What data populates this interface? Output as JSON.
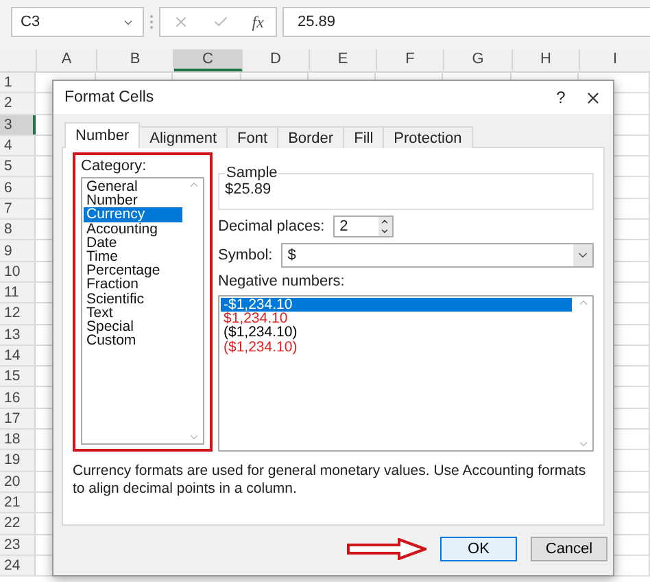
{
  "formula_bar": {
    "name_box": "C3",
    "function_label": "fx",
    "formula": "25.89"
  },
  "grid": {
    "columns": [
      {
        "label": "A",
        "selected": false
      },
      {
        "label": "B",
        "selected": false
      },
      {
        "label": "C",
        "selected": true
      },
      {
        "label": "D",
        "selected": false
      },
      {
        "label": "E",
        "selected": false
      },
      {
        "label": "F",
        "selected": false
      },
      {
        "label": "G",
        "selected": false
      },
      {
        "label": "H",
        "selected": false
      },
      {
        "label": "I",
        "selected": false
      }
    ],
    "rows": [
      {
        "label": "1",
        "selected": false
      },
      {
        "label": "2",
        "selected": false
      },
      {
        "label": "3",
        "selected": true
      },
      {
        "label": "4",
        "selected": false
      },
      {
        "label": "5",
        "selected": false
      },
      {
        "label": "6",
        "selected": false
      },
      {
        "label": "7",
        "selected": false
      },
      {
        "label": "8",
        "selected": false
      },
      {
        "label": "9",
        "selected": false
      },
      {
        "label": "10",
        "selected": false
      },
      {
        "label": "11",
        "selected": false
      },
      {
        "label": "12",
        "selected": false
      },
      {
        "label": "13",
        "selected": false
      },
      {
        "label": "14",
        "selected": false
      },
      {
        "label": "15",
        "selected": false
      },
      {
        "label": "16",
        "selected": false
      },
      {
        "label": "17",
        "selected": false
      },
      {
        "label": "18",
        "selected": false
      },
      {
        "label": "19",
        "selected": false
      },
      {
        "label": "20",
        "selected": false
      },
      {
        "label": "21",
        "selected": false
      },
      {
        "label": "22",
        "selected": false
      },
      {
        "label": "23",
        "selected": false
      },
      {
        "label": "24",
        "selected": false
      }
    ]
  },
  "dialog": {
    "title": "Format Cells",
    "help": "?",
    "tabs": [
      {
        "label": "Number",
        "selected": true
      },
      {
        "label": "Alignment",
        "selected": false
      },
      {
        "label": "Font",
        "selected": false
      },
      {
        "label": "Border",
        "selected": false
      },
      {
        "label": "Fill",
        "selected": false
      },
      {
        "label": "Protection",
        "selected": false
      }
    ],
    "category_label": "Category:",
    "categories": [
      {
        "label": "General",
        "selected": false
      },
      {
        "label": "Number",
        "selected": false
      },
      {
        "label": "Currency",
        "selected": true
      },
      {
        "label": "Accounting",
        "selected": false
      },
      {
        "label": "Date",
        "selected": false
      },
      {
        "label": "Time",
        "selected": false
      },
      {
        "label": "Percentage",
        "selected": false
      },
      {
        "label": "Fraction",
        "selected": false
      },
      {
        "label": "Scientific",
        "selected": false
      },
      {
        "label": "Text",
        "selected": false
      },
      {
        "label": "Special",
        "selected": false
      },
      {
        "label": "Custom",
        "selected": false
      }
    ],
    "sample": {
      "label": "Sample",
      "value": "$25.89"
    },
    "decimal_places": {
      "label": "Decimal places:",
      "value": "2"
    },
    "symbol": {
      "label": "Symbol:",
      "value": "$"
    },
    "negative_numbers_label": "Negative numbers:",
    "negative_numbers": [
      {
        "label": "-$1,234.10",
        "selected": true,
        "color": "#ffffff"
      },
      {
        "label": "$1,234.10",
        "selected": false,
        "color": "#e02020"
      },
      {
        "label": "($1,234.10)",
        "selected": false,
        "color": "#000000"
      },
      {
        "label": "($1,234.10)",
        "selected": false,
        "color": "#e02020"
      }
    ],
    "description": "Currency formats are used for general monetary values.  Use Accounting formats to align decimal points in a column.",
    "buttons": [
      {
        "label": "OK",
        "default": true
      },
      {
        "label": "Cancel",
        "default": false
      }
    ]
  }
}
